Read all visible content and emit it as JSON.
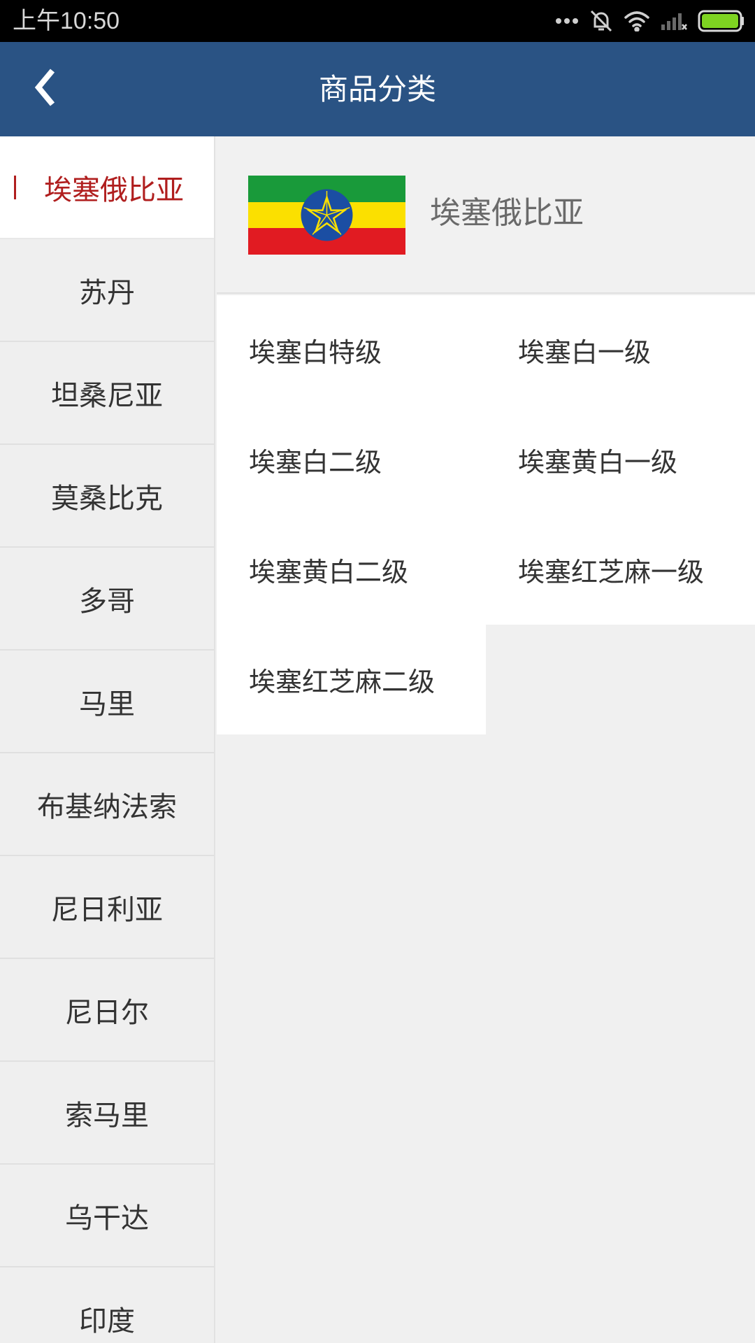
{
  "status_bar": {
    "time": "上午10:50",
    "icons": [
      "more-dots-icon",
      "notifications-off-icon",
      "wifi-icon",
      "signal-icon",
      "battery-icon"
    ],
    "battery_color": "#7ed321"
  },
  "header": {
    "title": "商品分类",
    "background": "#2a5384",
    "back_icon": "chevron-left-icon"
  },
  "sidebar": {
    "active_color": "#b01e1e",
    "items": [
      {
        "label": "埃塞俄比亚",
        "active": true
      },
      {
        "label": "苏丹"
      },
      {
        "label": "坦桑尼亚"
      },
      {
        "label": "莫桑比克"
      },
      {
        "label": "多哥"
      },
      {
        "label": "马里"
      },
      {
        "label": "布基纳法索"
      },
      {
        "label": "尼日利亚"
      },
      {
        "label": "尼日尔"
      },
      {
        "label": "索马里"
      },
      {
        "label": "乌干达"
      },
      {
        "label": "印度"
      }
    ]
  },
  "main": {
    "country": {
      "name": "埃塞俄比亚",
      "flag_icon": "ethiopia-flag-icon"
    },
    "grades": [
      "埃塞白特级",
      "埃塞白一级",
      "埃塞白二级",
      "埃塞黄白一级",
      "埃塞黄白二级",
      "埃塞红芝麻一级",
      "埃塞红芝麻二级"
    ]
  }
}
